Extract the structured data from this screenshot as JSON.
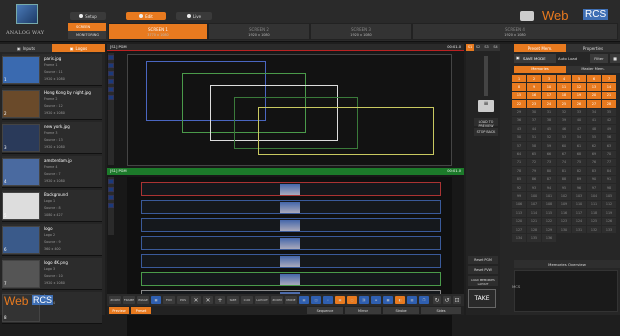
{
  "header": {
    "logo_text": "ANALOG WAY",
    "modes": [
      {
        "label": "Setup",
        "active": false
      },
      {
        "label": "Edit",
        "active": true
      },
      {
        "label": "Live",
        "active": false
      }
    ],
    "left_selector": [
      "SCREEN",
      "MONITORING"
    ],
    "screens": [
      {
        "label": "SCREEN 1",
        "res": "3770 x 1080",
        "active": true
      },
      {
        "label": "SCREEN 2",
        "res": "1920 x 1080",
        "active": false
      },
      {
        "label": "SCREEN 3",
        "res": "1920 x 1080",
        "active": false
      },
      {
        "label": "SCREEN 4",
        "res": "1920 x 1080",
        "active": false
      }
    ],
    "brand_web": "Web",
    "brand_rcs": "RCS"
  },
  "left": {
    "tabs": [
      {
        "label": "Inputs"
      },
      {
        "label": "Logos"
      }
    ],
    "sources": [
      {
        "name": "paris.jpg",
        "lines": [
          "Frame 1",
          "Source : 11",
          "1920 x 1080"
        ],
        "num": "1",
        "color": "#3a6ab0"
      },
      {
        "name": "Hong Kong by night.jpg",
        "lines": [
          "Frame 2",
          "Source : 12",
          "1920 x 1080"
        ],
        "num": "2",
        "color": "#6a4a2a"
      },
      {
        "name": "new york.jpg",
        "lines": [
          "Frame 3",
          "Source : 13",
          "1920 x 1080"
        ],
        "num": "3",
        "color": "#2a3a5a"
      },
      {
        "name": "amsterdam.jp",
        "lines": [
          "Frame 4",
          "Source : 7",
          "1920 x 1080"
        ],
        "num": "4",
        "color": "#4a6aa0"
      },
      {
        "name": "Background",
        "lines": [
          "Logo 1",
          "Source : 8",
          "1080 x 427"
        ],
        "num": "5",
        "color": "#ddd"
      },
      {
        "name": "logo",
        "lines": [
          "Logo 2",
          "Source : 9",
          "360 x 400"
        ],
        "num": "6",
        "color": "#3a5a8a"
      },
      {
        "name": "logo 4K.png",
        "lines": [
          "Logo 3",
          "Source : 10",
          "1920 x 1080"
        ],
        "num": "7",
        "color": "#555"
      },
      {
        "name": "logo",
        "lines": [
          "Logo 4",
          "",
          ""
        ],
        "num": "8",
        "color": "#333"
      }
    ]
  },
  "center": {
    "pvw_label": "[S1] PGM",
    "pvw_right": "00:01.0",
    "pgm_label": "[S1] PGM",
    "pgm_right": "00:01.0"
  },
  "toolbar": {
    "items": [
      "ZOOM",
      "FRAME",
      "IMAGE",
      "FOV",
      "POS",
      "SIZE",
      "0.00",
      "LAYOUT",
      "ZOOM",
      "MODE"
    ]
  },
  "bottom_tabs": [
    {
      "label": "Preview",
      "active": true
    },
    {
      "label": "Preset",
      "active": true
    },
    {
      "label": "Sequence",
      "active": false
    },
    {
      "label": "Mirror",
      "active": false
    },
    {
      "label": "Strobe",
      "active": false
    },
    {
      "label": "Sides",
      "active": false
    }
  ],
  "right1": {
    "tabs": [
      "S1",
      "S2",
      "S3",
      "S4"
    ],
    "buttons": [
      "LOAD TO PREVIEW",
      "STOP BACK"
    ],
    "reset_pgm": "Reset PGM",
    "reset_pvw": "Reset PVW",
    "load_mem": "LOAD MEMORIES LAYOUT",
    "take": "TAKE",
    "cut": "CUT",
    "mix": "MIX"
  },
  "right2": {
    "tabs": [
      "Preset Mem.",
      "Properties"
    ],
    "save_mode": "SAVE MODE",
    "autoload": "Auto Load",
    "filter": "Filter",
    "sub_tabs": [
      "Memories",
      "Master Mem."
    ],
    "memories_overview": "Memories Overview",
    "mcs": "MCS",
    "memories": [
      1,
      2,
      3,
      4,
      5,
      6,
      7,
      8,
      9,
      10,
      11,
      12,
      13,
      14,
      15,
      16,
      17,
      18,
      19,
      20,
      21,
      22,
      23,
      24,
      25,
      26,
      27,
      28,
      29,
      30,
      31,
      32,
      33,
      34,
      35,
      36,
      37,
      38,
      39,
      40,
      41,
      42,
      43,
      44,
      45,
      46,
      47,
      48,
      49,
      50,
      51,
      52,
      53,
      54,
      55,
      56,
      57,
      58,
      59,
      60,
      61,
      62,
      63,
      64,
      65,
      66,
      67,
      68,
      69,
      70,
      71,
      72,
      73,
      74,
      75,
      76,
      77,
      78,
      79,
      80,
      81,
      82,
      83,
      84,
      85,
      86,
      87,
      88,
      89,
      90,
      91,
      92,
      93,
      94,
      95,
      96,
      97,
      98,
      99,
      100,
      101,
      102,
      103,
      104,
      105,
      106,
      107,
      108,
      109,
      110,
      111,
      112,
      113,
      114,
      115,
      116,
      117,
      118,
      119,
      120,
      121,
      122,
      123,
      124,
      125,
      126,
      127,
      128,
      129,
      130,
      131,
      132,
      133,
      134,
      135,
      136
    ],
    "active_memories": [
      1,
      2,
      3,
      4,
      5,
      6,
      7,
      8,
      9,
      10,
      11,
      12,
      13,
      14,
      15,
      16,
      17,
      18,
      19,
      20,
      21,
      22,
      23,
      24,
      25,
      26,
      27,
      28
    ]
  },
  "colors": {
    "accent": "#e87a1f",
    "blue": "#3f6fb4",
    "pgm_green": "#1c7a2a"
  }
}
